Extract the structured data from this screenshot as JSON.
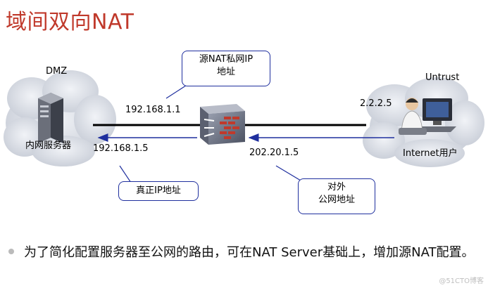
{
  "title": "域间双向NAT",
  "zones": {
    "dmz": "DMZ",
    "untrust": "Untrust"
  },
  "devices": {
    "server_label": "内网服务器",
    "user_label": "Internet用户"
  },
  "addresses": {
    "fw_private": "192.168.1.1",
    "server_real": "192.168.1.5",
    "fw_public": "202.20.1.5",
    "user_ip": "2.2.2.5"
  },
  "callouts": {
    "src_nat_line1": "源NAT私网IP",
    "src_nat_line2": "地址",
    "real_ip": "真正IP地址",
    "external_line1": "对外",
    "external_line2": "公网地址"
  },
  "bullet": "为了简化配置服务器至公网的路由，可在NAT Server基础上，增加源NAT配置。",
  "watermark": "@51CTO博客",
  "colors": {
    "title": "#c0392b",
    "callout_border": "#1f2f9e",
    "arrow": "#1f2f9e",
    "cloud": "#d4d8e0"
  }
}
